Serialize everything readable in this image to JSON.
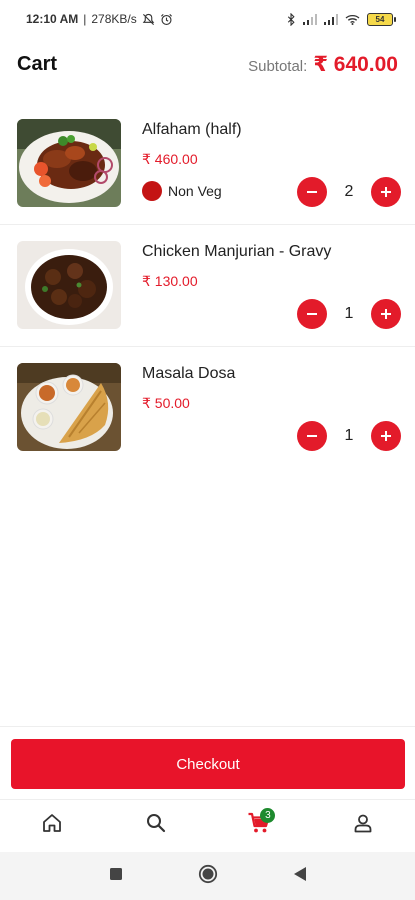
{
  "status_bar": {
    "time": "12:10 AM",
    "network_speed": "278KB/s",
    "battery": "54",
    "icons": [
      "mute-icon",
      "alarm-icon",
      "bluetooth-icon",
      "signal-icon",
      "signal-icon",
      "wifi-icon",
      "battery-icon"
    ]
  },
  "header": {
    "title": "Cart",
    "subtotal_label": "Subtotal:",
    "subtotal_amount": "₹ 640.00"
  },
  "items": [
    {
      "name": "Alfaham (half)",
      "price": "₹ 460.00",
      "tag": "Non Veg",
      "quantity": "2",
      "image": "grilled-chicken-plate"
    },
    {
      "name": "Chicken Manjurian - Gravy",
      "price": "₹ 130.00",
      "quantity": "1",
      "image": "chicken-manchurian-bowl"
    },
    {
      "name": "Masala Dosa",
      "price": "₹ 50.00",
      "quantity": "1",
      "image": "masala-dosa-plate"
    }
  ],
  "checkout": {
    "label": "Checkout"
  },
  "bottom_nav": {
    "items": [
      "home-icon",
      "search-icon",
      "cart-icon",
      "profile-icon"
    ],
    "cart_count": "3",
    "active": "cart-icon"
  },
  "colors": {
    "accent": "#e31b2a",
    "badge": "#1e8a2e",
    "non_veg": "#c41414"
  }
}
